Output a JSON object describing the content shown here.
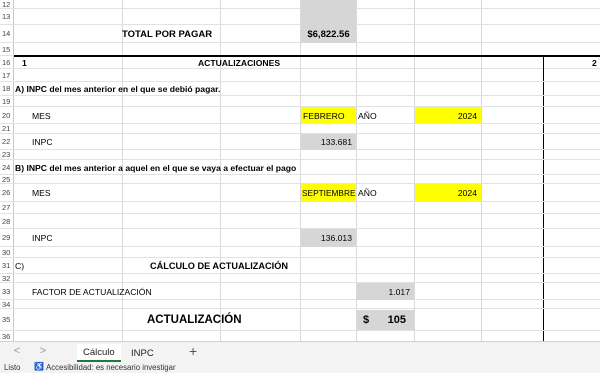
{
  "rows": {
    "r12": "12",
    "r13": "13",
    "r14": "14",
    "r15": "15",
    "r16": "16",
    "r17": "17",
    "r18": "18",
    "r19": "19",
    "r20": "20",
    "r21": "21",
    "r22": "22",
    "r23": "23",
    "r24": "24",
    "r25": "25",
    "r26": "26",
    "r27": "27",
    "r28": "28",
    "r29": "29",
    "r30": "30",
    "r31": "31",
    "r32": "32",
    "r33": "33",
    "r34": "34",
    "r35": "35",
    "r36": "36"
  },
  "total": {
    "label": "TOTAL POR PAGAR",
    "value": "$6,822.56"
  },
  "section": {
    "number": "1",
    "title": "ACTUALIZACIONES",
    "right_number": "2"
  },
  "part_a": {
    "heading": "A)  INPC del mes anterior en el que se debió pagar.",
    "mes_label": "MES",
    "mes_value": "FEBRERO",
    "anio_label": "AÑO",
    "anio_value": "2024",
    "inpc_label": "INPC",
    "inpc_value": "133.681"
  },
  "part_b": {
    "heading": "B)  INPC del mes anterior a aquel en el que se vaya a efectuar el pago",
    "mes_label": "MES",
    "mes_value": "SEPTIEMBRE",
    "anio_label": "AÑO",
    "anio_value": "2024",
    "inpc_label": "INPC",
    "inpc_value": "136.013"
  },
  "part_c": {
    "letter": "C)",
    "title": "CÁLCULO DE ACTUALIZACIÓN",
    "factor_label": "FACTOR DE ACTUALIZACIÓN",
    "factor_value": "1.017",
    "actualizacion_label": "ACTUALIZACIÓN",
    "currency": "$",
    "actualizacion_value": "105"
  },
  "tabs": {
    "active": "Cálculo",
    "other": "INPC",
    "add": "+"
  },
  "nav": {
    "prev": "<",
    "next": ">",
    "more": "..."
  },
  "status": {
    "ready": "Listo",
    "accessibility": "Accesibilidad: es necesario investigar"
  }
}
